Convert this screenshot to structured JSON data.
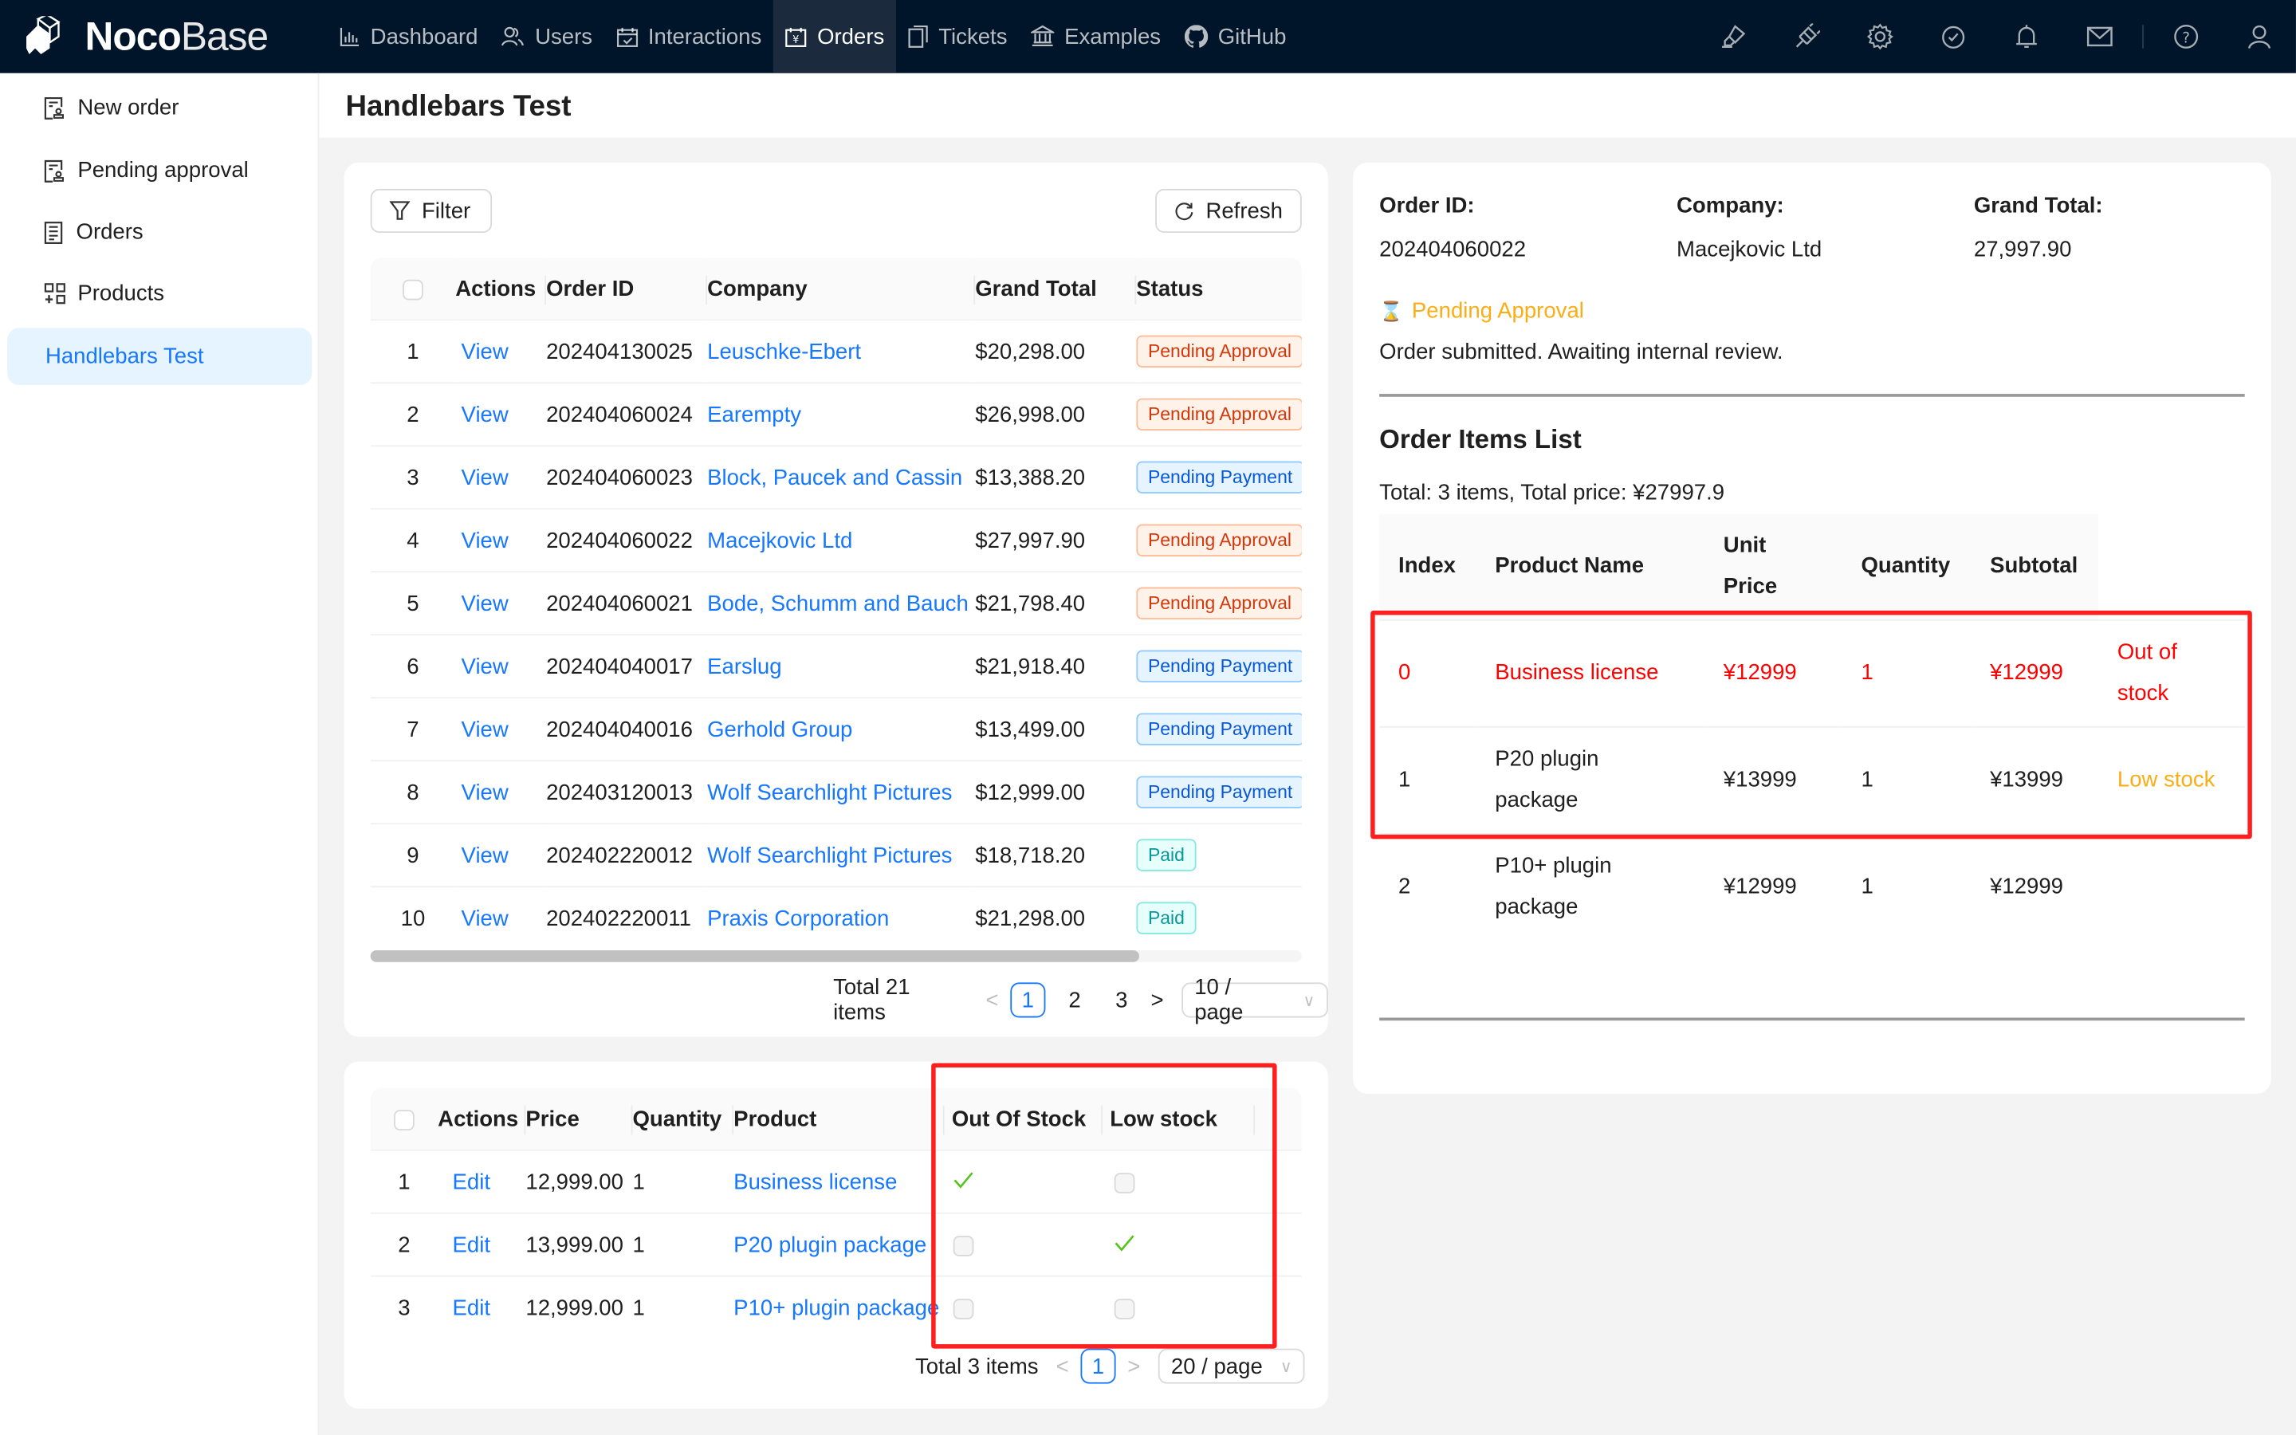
{
  "app": {
    "logo_bold": "Noco",
    "logo_light": "Base"
  },
  "nav": [
    {
      "label": "Dashboard",
      "icon": "bar-chart-icon",
      "active": false
    },
    {
      "label": "Users",
      "icon": "users-icon",
      "active": false
    },
    {
      "label": "Interactions",
      "icon": "calendar-check-icon",
      "active": false
    },
    {
      "label": "Orders",
      "icon": "yen-calendar-icon",
      "active": true
    },
    {
      "label": "Tickets",
      "icon": "copy-icon",
      "active": false
    },
    {
      "label": "Examples",
      "icon": "bank-icon",
      "active": false
    },
    {
      "label": "GitHub",
      "icon": "github-icon",
      "active": false
    }
  ],
  "header_icons": [
    "highlight-icon",
    "plugin-icon",
    "settings-icon",
    "check-circle-icon",
    "bell-icon",
    "mail-icon",
    "help-icon",
    "user-icon"
  ],
  "sidebar": {
    "items": [
      {
        "label": "New order",
        "icon": "form-stamp-icon",
        "active": false
      },
      {
        "label": "Pending approval",
        "icon": "form-stamp-icon",
        "active": false
      },
      {
        "label": "Orders",
        "icon": "document-icon",
        "active": false
      },
      {
        "label": "Products",
        "icon": "appstore-add-icon",
        "active": false
      },
      {
        "label": "Handlebars Test",
        "icon": "",
        "active": true
      }
    ]
  },
  "page": {
    "title": "Handlebars Test"
  },
  "orders_block": {
    "filter_label": "Filter",
    "refresh_label": "Refresh",
    "columns": [
      "Actions",
      "Order ID",
      "Company",
      "Grand Total",
      "Status"
    ],
    "rows": [
      {
        "index": "1",
        "action": "View",
        "order_id": "202404130025",
        "company": "Leuschke-Ebert",
        "total": "$20,298.00",
        "status": "Pending Approval",
        "status_type": "approval"
      },
      {
        "index": "2",
        "action": "View",
        "order_id": "202404060024",
        "company": "Earempty",
        "total": "$26,998.00",
        "status": "Pending Approval",
        "status_type": "approval"
      },
      {
        "index": "3",
        "action": "View",
        "order_id": "202404060023",
        "company": "Block, Paucek and Cassin",
        "total": "$13,388.20",
        "status": "Pending Payment",
        "status_type": "payment"
      },
      {
        "index": "4",
        "action": "View",
        "order_id": "202404060022",
        "company": "Macejkovic Ltd",
        "total": "$27,997.90",
        "status": "Pending Approval",
        "status_type": "approval"
      },
      {
        "index": "5",
        "action": "View",
        "order_id": "202404060021",
        "company": "Bode, Schumm and Bauch",
        "total": "$21,798.40",
        "status": "Pending Approval",
        "status_type": "approval"
      },
      {
        "index": "6",
        "action": "View",
        "order_id": "202404040017",
        "company": "Earslug",
        "total": "$21,918.40",
        "status": "Pending Payment",
        "status_type": "payment"
      },
      {
        "index": "7",
        "action": "View",
        "order_id": "202404040016",
        "company": "Gerhold Group",
        "total": "$13,499.00",
        "status": "Pending Payment",
        "status_type": "payment"
      },
      {
        "index": "8",
        "action": "View",
        "order_id": "202403120013",
        "company": "Wolf Searchlight Pictures",
        "total": "$12,999.00",
        "status": "Pending Payment",
        "status_type": "payment"
      },
      {
        "index": "9",
        "action": "View",
        "order_id": "202402220012",
        "company": "Wolf Searchlight Pictures",
        "total": "$18,718.20",
        "status": "Paid",
        "status_type": "paid"
      },
      {
        "index": "10",
        "action": "View",
        "order_id": "202402220011",
        "company": "Praxis Corporation",
        "total": "$21,298.00",
        "status": "Paid",
        "status_type": "paid"
      }
    ],
    "pagination": {
      "total_text": "Total 21 items",
      "pages": [
        "1",
        "2",
        "3"
      ],
      "current": "1",
      "page_size": "10 / page"
    }
  },
  "items_block": {
    "columns": [
      "Actions",
      "Price",
      "Quantity",
      "Product",
      "Out Of Stock",
      "Low stock"
    ],
    "rows": [
      {
        "index": "1",
        "action": "Edit",
        "price": "12,999.00",
        "quantity": "1",
        "product": "Business license",
        "out_of_stock": true,
        "low_stock": false
      },
      {
        "index": "2",
        "action": "Edit",
        "price": "13,999.00",
        "quantity": "1",
        "product": "P20 plugin package",
        "out_of_stock": false,
        "low_stock": true
      },
      {
        "index": "3",
        "action": "Edit",
        "price": "12,999.00",
        "quantity": "1",
        "product": "P10+ plugin package",
        "out_of_stock": false,
        "low_stock": false
      }
    ],
    "pagination": {
      "total_text": "Total 3 items",
      "current": "1",
      "page_size": "20 / page"
    }
  },
  "detail": {
    "order_id_label": "Order ID:",
    "order_id": "202404060022",
    "company_label": "Company:",
    "company": "Macejkovic Ltd",
    "grand_total_label": "Grand Total:",
    "grand_total": "27,997.90",
    "status_icon": "⌛",
    "status": "Pending Approval",
    "status_color": "#faad14",
    "status_message": "Order submitted. Awaiting internal review.",
    "items_title": "Order Items List",
    "items_summary": "Total: 3 items, Total price: ¥27997.9",
    "columns": [
      "Index",
      "Product Name",
      "Unit Price",
      "Quantity",
      "Subtotal"
    ],
    "rows": [
      {
        "index": "0",
        "name": "Business license",
        "unit_price": "¥12999",
        "quantity": "1",
        "subtotal": "¥12999",
        "stock_note": "Out of stock",
        "note_type": "out"
      },
      {
        "index": "1",
        "name": "P20 plugin package",
        "unit_price": "¥13999",
        "quantity": "1",
        "subtotal": "¥13999",
        "stock_note": "Low stock",
        "note_type": "low"
      },
      {
        "index": "2",
        "name": "P10+ plugin package",
        "unit_price": "¥12999",
        "quantity": "1",
        "subtotal": "¥12999",
        "stock_note": "",
        "note_type": ""
      }
    ]
  },
  "colors": {
    "header_bg": "#001529",
    "primary": "#1677ff",
    "highlight_red": "#ff1f1f",
    "check_green": "#52c41a",
    "low_stock": "#faad14"
  }
}
